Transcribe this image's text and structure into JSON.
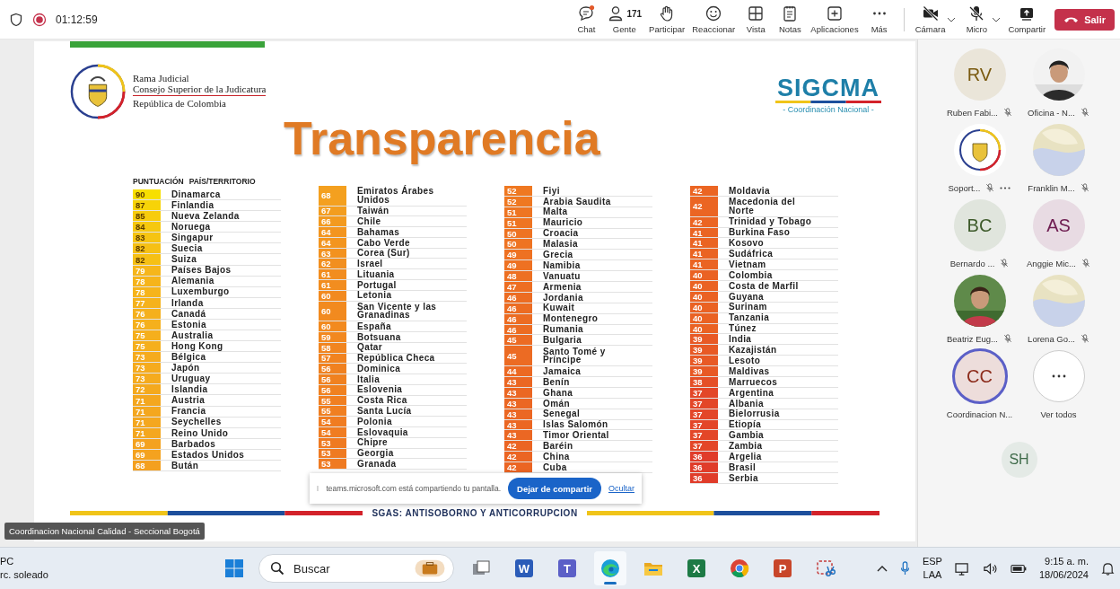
{
  "call": {
    "time": "01:12:59",
    "recording": true
  },
  "toolbar": [
    {
      "kind": "chat",
      "label": "Chat",
      "badge": true
    },
    {
      "kind": "people",
      "label": "Gente",
      "count": "171"
    },
    {
      "kind": "hand",
      "label": "Participar"
    },
    {
      "kind": "smile",
      "label": "Reaccionar"
    },
    {
      "kind": "grid",
      "label": "Vista"
    },
    {
      "kind": "notes",
      "label": "Notas"
    },
    {
      "kind": "plus",
      "label": "Aplicaciones"
    },
    {
      "kind": "dots",
      "label": "Más"
    }
  ],
  "devices": [
    {
      "kind": "camera",
      "label": "Cámara",
      "off": true,
      "caret": true
    },
    {
      "kind": "mic",
      "label": "Micro",
      "off": true,
      "caret": true
    },
    {
      "kind": "share",
      "label": "Compartir"
    }
  ],
  "leave_button": "Salir",
  "slide": {
    "org_lines": [
      "Rama Judicial",
      "Consejo Superior de la Judicatura",
      "República de Colombia"
    ],
    "brand": "SIGCMA",
    "brand_subtitle": "- Coordinación Nacional -",
    "title": "Transparencia",
    "table": {
      "header": {
        "score": "PUNTUACIÓN",
        "country": "PAÍS/TERRITORIO"
      },
      "columns": [
        [
          {
            "score": "90",
            "country": "Dinamarca"
          },
          {
            "score": "87",
            "country": "Finlandia"
          },
          {
            "score": "85",
            "country": "Nueva Zelanda"
          },
          {
            "score": "84",
            "country": "Noruega"
          },
          {
            "score": "83",
            "country": "Singapur"
          },
          {
            "score": "82",
            "country": "Suecia"
          },
          {
            "score": "82",
            "country": "Suiza"
          },
          {
            "score": "79",
            "country": "Países Bajos"
          },
          {
            "score": "78",
            "country": "Alemania"
          },
          {
            "score": "78",
            "country": "Luxemburgo"
          },
          {
            "score": "77",
            "country": "Irlanda"
          },
          {
            "score": "76",
            "country": "Canadá"
          },
          {
            "score": "76",
            "country": "Estonia"
          },
          {
            "score": "75",
            "country": "Australia"
          },
          {
            "score": "75",
            "country": "Hong Kong"
          },
          {
            "score": "73",
            "country": "Bélgica"
          },
          {
            "score": "73",
            "country": "Japón"
          },
          {
            "score": "73",
            "country": "Uruguay"
          },
          {
            "score": "72",
            "country": "Islandia"
          },
          {
            "score": "71",
            "country": "Austria"
          },
          {
            "score": "71",
            "country": "Francia"
          },
          {
            "score": "71",
            "country": "Seychelles"
          },
          {
            "score": "71",
            "country": "Reino Unido"
          },
          {
            "score": "69",
            "country": "Barbados"
          },
          {
            "score": "69",
            "country": "Estados Unidos"
          },
          {
            "score": "68",
            "country": "Bután"
          }
        ],
        [
          {
            "score": "68",
            "country": "Emiratos Árabes\nUnidos"
          },
          {
            "score": "67",
            "country": "Taiwán"
          },
          {
            "score": "66",
            "country": "Chile"
          },
          {
            "score": "64",
            "country": "Bahamas"
          },
          {
            "score": "64",
            "country": "Cabo Verde"
          },
          {
            "score": "63",
            "country": "Corea (Sur)"
          },
          {
            "score": "62",
            "country": "Israel"
          },
          {
            "score": "61",
            "country": "Lituania"
          },
          {
            "score": "61",
            "country": "Portugal"
          },
          {
            "score": "60",
            "country": "Letonia"
          },
          {
            "score": "60",
            "country": "San Vicente y las\nGranadinas"
          },
          {
            "score": "60",
            "country": "España"
          },
          {
            "score": "59",
            "country": "Botsuana"
          },
          {
            "score": "58",
            "country": "Qatar"
          },
          {
            "score": "57",
            "country": "República Checa"
          },
          {
            "score": "56",
            "country": "Dominica"
          },
          {
            "score": "56",
            "country": "Italia"
          },
          {
            "score": "56",
            "country": "Eslovenia"
          },
          {
            "score": "55",
            "country": "Costa Rica"
          },
          {
            "score": "55",
            "country": "Santa Lucía"
          },
          {
            "score": "54",
            "country": "Polonia"
          },
          {
            "score": "54",
            "country": "Eslovaquia"
          },
          {
            "score": "53",
            "country": "Chipre"
          },
          {
            "score": "53",
            "country": "Georgia"
          },
          {
            "score": "53",
            "country": "Granada"
          }
        ],
        [
          {
            "score": "52",
            "country": "Fiyi"
          },
          {
            "score": "52",
            "country": "Arabia Saudita"
          },
          {
            "score": "51",
            "country": "Malta"
          },
          {
            "score": "51",
            "country": "Mauricio"
          },
          {
            "score": "50",
            "country": "Croacia"
          },
          {
            "score": "50",
            "country": "Malasia"
          },
          {
            "score": "49",
            "country": "Grecia"
          },
          {
            "score": "49",
            "country": "Namibia"
          },
          {
            "score": "48",
            "country": "Vanuatu"
          },
          {
            "score": "47",
            "country": "Armenia"
          },
          {
            "score": "46",
            "country": "Jordania"
          },
          {
            "score": "46",
            "country": "Kuwait"
          },
          {
            "score": "46",
            "country": "Montenegro"
          },
          {
            "score": "46",
            "country": "Rumania"
          },
          {
            "score": "45",
            "country": "Bulgaria"
          },
          {
            "score": "45",
            "country": "Santo Tomé y\nPríncipe"
          },
          {
            "score": "44",
            "country": "Jamaica"
          },
          {
            "score": "43",
            "country": "Benín"
          },
          {
            "score": "43",
            "country": "Ghana"
          },
          {
            "score": "43",
            "country": "Omán"
          },
          {
            "score": "43",
            "country": "Senegal"
          },
          {
            "score": "43",
            "country": "Islas Salomón"
          },
          {
            "score": "43",
            "country": "Timor Oriental"
          },
          {
            "score": "42",
            "country": "Baréin"
          },
          {
            "score": "42",
            "country": "China"
          },
          {
            "score": "42",
            "country": "Cuba"
          }
        ],
        [
          {
            "score": "42",
            "country": "Moldavia"
          },
          {
            "score": "42",
            "country": "Macedonia del\nNorte"
          },
          {
            "score": "42",
            "country": "Trinidad y Tobago"
          },
          {
            "score": "41",
            "country": "Burkina Faso"
          },
          {
            "score": "41",
            "country": "Kosovo"
          },
          {
            "score": "41",
            "country": "Sudáfrica"
          },
          {
            "score": "41",
            "country": "Vietnam"
          },
          {
            "score": "40",
            "country": "Colombia"
          },
          {
            "score": "40",
            "country": "Costa de Marfil"
          },
          {
            "score": "40",
            "country": "Guyana"
          },
          {
            "score": "40",
            "country": "Surinam"
          },
          {
            "score": "40",
            "country": "Tanzania"
          },
          {
            "score": "40",
            "country": "Túnez"
          },
          {
            "score": "39",
            "country": "India"
          },
          {
            "score": "39",
            "country": "Kazajistán"
          },
          {
            "score": "39",
            "country": "Lesoto"
          },
          {
            "score": "39",
            "country": "Maldivas"
          },
          {
            "score": "38",
            "country": "Marruecos"
          },
          {
            "score": "37",
            "country": "Argentina"
          },
          {
            "score": "37",
            "country": "Albania"
          },
          {
            "score": "37",
            "country": "Bielorrusia"
          },
          {
            "score": "37",
            "country": "Etiopía"
          },
          {
            "score": "37",
            "country": "Gambia"
          },
          {
            "score": "37",
            "country": "Zambia"
          },
          {
            "score": "36",
            "country": "Argelia"
          },
          {
            "score": "36",
            "country": "Brasil"
          },
          {
            "score": "36",
            "country": "Serbia"
          }
        ]
      ]
    },
    "footer": "SGAS: ANTISOBORNO Y ANTICORRUPCION"
  },
  "share_bar": {
    "message": "teams.microsoft.com está compartiendo tu pantalla.",
    "stop_button": "Dejar de compartir",
    "hide_link": "Ocultar"
  },
  "presenter_label": "Coordinacion Nacional Calidad - Seccional Bogotá",
  "participants": [
    {
      "kind": "initials",
      "initials": "RV",
      "color": "#7a5a10",
      "name": "Ruben Fabi...",
      "muted": true
    },
    {
      "name": "Oficina - N...",
      "muted": true
    },
    {
      "kind": "logo",
      "name": "Soport...",
      "muted": true,
      "more": true
    },
    {
      "name": "Franklin M...",
      "muted": true
    },
    {
      "kind": "initials",
      "initials": "BC",
      "color": "#3d5a2a",
      "name": "Bernardo ...",
      "muted": true
    },
    {
      "kind": "initials",
      "initials": "AS",
      "color": "#6e1c50",
      "name": "Anggie Mic...",
      "muted": true
    },
    {
      "name": "Beatriz Eug...",
      "muted": true
    },
    {
      "name": "Lorena Go...",
      "muted": true
    },
    {
      "kind": "initials",
      "initials": "CC",
      "color": "#8c2c1c",
      "name": "Coordinacion N...",
      "muted": false,
      "speaking": true
    },
    {
      "kind": "see_all",
      "name": "Ver todos"
    }
  ],
  "extra_participant": {
    "initials": "SH",
    "color": "#3f6b4a"
  },
  "taskbar": {
    "weather": [
      "PC",
      "rc. soleado"
    ],
    "search_placeholder": "Buscar",
    "apps": [
      {
        "kind": "taskview",
        "active": false
      },
      {
        "kind": "word",
        "letter": "W",
        "active": false
      },
      {
        "kind": "teams",
        "letter": "T",
        "active": false
      },
      {
        "kind": "edge",
        "active": true
      },
      {
        "kind": "folder",
        "active": false
      },
      {
        "kind": "excel",
        "letter": "X",
        "active": false
      },
      {
        "kind": "chrome",
        "active": false
      },
      {
        "kind": "powerpoint",
        "letter": "P",
        "active": false
      },
      {
        "kind": "snip",
        "active": false
      }
    ],
    "language": [
      "ESP",
      "LAA"
    ],
    "time": "9:15 a. m.",
    "date": "18/06/2024"
  }
}
